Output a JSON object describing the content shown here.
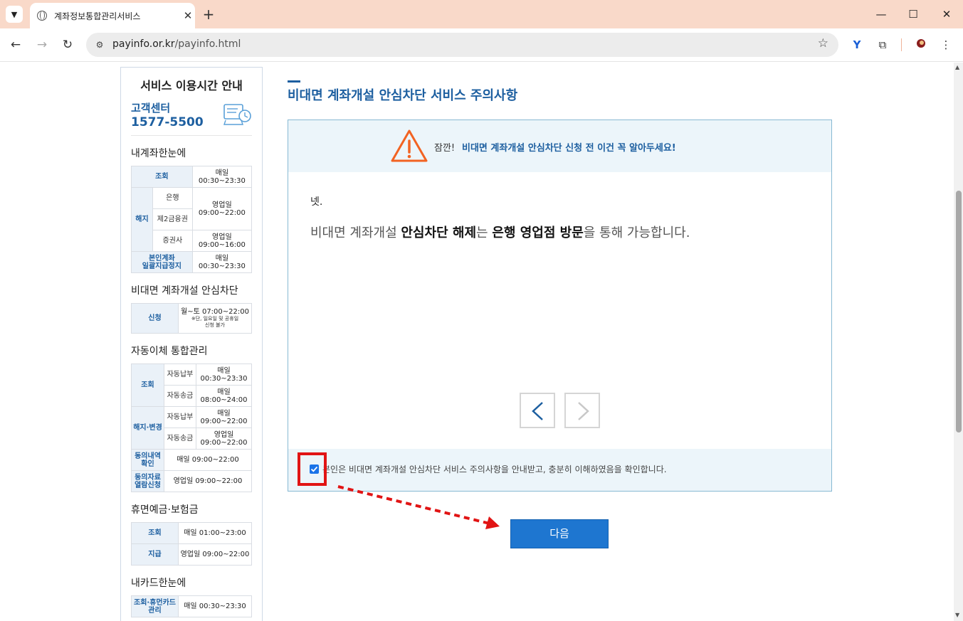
{
  "browser": {
    "tab_title": "계좌정보통합관리서비스",
    "url_domain": "payinfo.or.kr",
    "url_path": "/payinfo.html"
  },
  "sidebar": {
    "title": "서비스 이용시간 안내",
    "center_label": "고객센터",
    "center_phone": "1577-5500",
    "sec1": {
      "title": "내계좌한눈에",
      "inquiry": "조회",
      "inquiry_time": [
        "매일",
        "00:30~23:30"
      ],
      "cancel": "해지",
      "bank": "은행",
      "bank_time": [
        "영업일",
        "09:00~22:00"
      ],
      "fin2": "제2금융권",
      "securities": "증권사",
      "securities_time": [
        "영업일",
        "09:00~16:00"
      ],
      "self_acct": [
        "본인계좌",
        "일괄지급정지"
      ],
      "self_acct_time": [
        "매일",
        "00:30~23:30"
      ]
    },
    "sec2": {
      "title": "비대면 계좌개설 안심차단",
      "apply": "신청",
      "apply_time": "월~토 07:00~22:00",
      "apply_note": [
        "※단, 일요일 및 공휴일",
        "신청 불가"
      ]
    },
    "sec3": {
      "title": "자동이체 통합관리",
      "inquiry": "조회",
      "autopay": "자동납부",
      "autopay_time": [
        "매일",
        "00:30~23:30"
      ],
      "autosend": "자동송금",
      "autosend_time": [
        "매일",
        "08:00~24:00"
      ],
      "change": "해지·변경",
      "autopay2": "자동납부",
      "autopay2_time": [
        "매일",
        "09:00~22:00"
      ],
      "autosend2": "자동송금",
      "autosend2_time": [
        "영업일",
        "09:00~22:00"
      ],
      "consent": [
        "동의내역",
        "확인"
      ],
      "consent_time": "매일 09:00~22:00",
      "consent_doc": [
        "동의자료",
        "열람신청"
      ],
      "consent_doc_time": "영업일 09:00~22:00"
    },
    "sec4": {
      "title": "휴면예금·보험금",
      "inquiry": "조회",
      "inquiry_time": "매일 01:00~23:00",
      "pay": "지급",
      "pay_time": "영업일 09:00~22:00"
    },
    "sec5": {
      "title": "내카드한눈에",
      "row": [
        "조회·휴먼카드",
        "관리"
      ],
      "row_time": "매일 00:30~23:30"
    }
  },
  "main": {
    "heading": "비대면 계좌개설 안심차단 서비스 주의사항",
    "warn_prefix": "잠깐!",
    "warn_text": "비대면 계좌개설 안심차단 신청 전 이건 꼭 알아두세요!",
    "question_num": "넷.",
    "q_part1": "비대면 계좌개설 ",
    "q_bold1": "안심차단 해제",
    "q_part2": "는 ",
    "q_bold2": "은행 영업점 방문",
    "q_part3": "을 통해 가능합니다.",
    "confirm_text": "본인은 비대면 계좌개설 안심차단 서비스 주의사항을 안내받고, 충분히 이해하였음을 확인합니다.",
    "confirm_checked": true,
    "next_label": "다음"
  },
  "colors": {
    "accent": "#1d5fa0",
    "button": "#1e76d0",
    "warning": "#f26322",
    "annotation": "#e11414"
  }
}
